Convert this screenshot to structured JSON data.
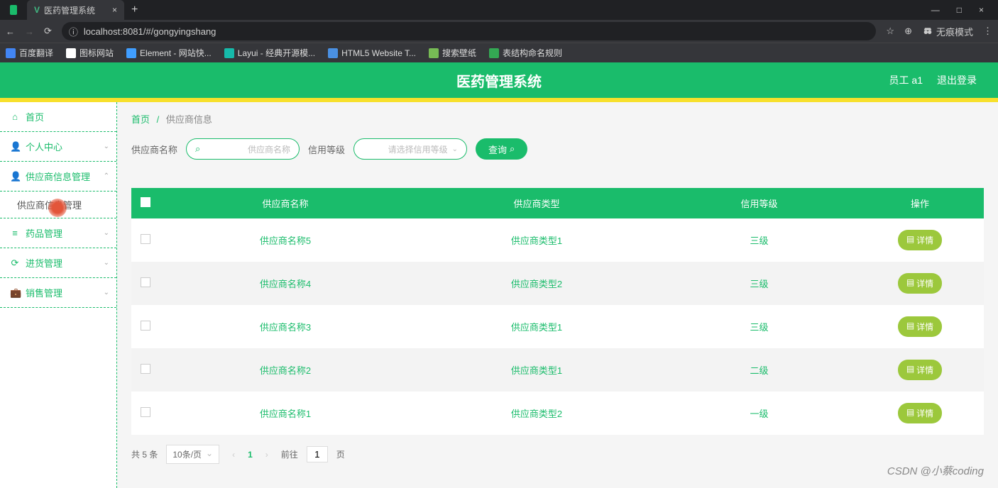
{
  "browser": {
    "tab_title": "医药管理系统",
    "url": "localhost:8081/#/gongyingshang",
    "incognito": "无痕模式",
    "bookmarks": [
      "百度翻译",
      "图标网站",
      "Element - 网站快...",
      "Layui - 经典开源模...",
      "HTML5 Website T...",
      "搜索壁纸",
      "表结构命名规则"
    ]
  },
  "header": {
    "title": "医药管理系统",
    "user": "员工 a1",
    "logout": "退出登录"
  },
  "sidebar": {
    "items": [
      {
        "icon": "⌂",
        "label": "首页"
      },
      {
        "icon": "👤",
        "label": "个人中心",
        "expand": true
      },
      {
        "icon": "👤",
        "label": "供应商信息管理",
        "expand": true
      },
      {
        "icon": "≡",
        "label": "药品管理",
        "expand": true
      },
      {
        "icon": "⟳",
        "label": "进货管理",
        "expand": true
      },
      {
        "icon": "💼",
        "label": "销售管理",
        "expand": true
      }
    ],
    "sub": "供应商信息管理"
  },
  "breadcrumb": {
    "home": "首页",
    "current": "供应商信息"
  },
  "search": {
    "name_label": "供应商名称",
    "name_placeholder": "供应商名称",
    "level_label": "信用等级",
    "level_placeholder": "请选择信用等级",
    "btn": "查询"
  },
  "table": {
    "cols": [
      "供应商名称",
      "供应商类型",
      "信用等级",
      "操作"
    ],
    "detail_btn": "详情",
    "rows": [
      {
        "name": "供应商名称5",
        "type": "供应商类型1",
        "level": "三级"
      },
      {
        "name": "供应商名称4",
        "type": "供应商类型2",
        "level": "三级"
      },
      {
        "name": "供应商名称3",
        "type": "供应商类型1",
        "level": "三级"
      },
      {
        "name": "供应商名称2",
        "type": "供应商类型1",
        "level": "二级"
      },
      {
        "name": "供应商名称1",
        "type": "供应商类型2",
        "level": "一级"
      }
    ]
  },
  "pager": {
    "total": "共 5 条",
    "size": "10条/页",
    "current": "1",
    "goto": "前往",
    "page_suffix": "页",
    "jump": "1"
  },
  "watermark": "CSDN @小蔡coding"
}
